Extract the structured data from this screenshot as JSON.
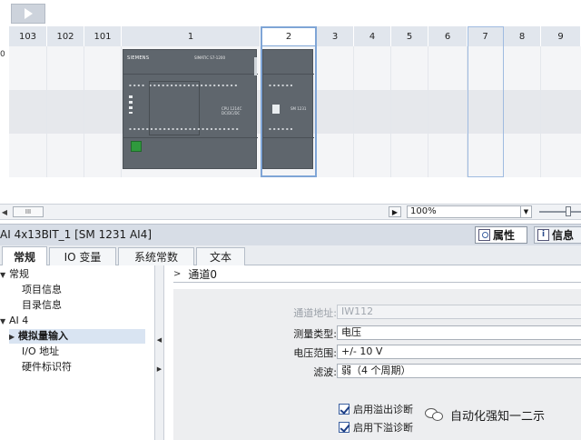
{
  "device_view": {
    "rail_label": "0",
    "slots": [
      "103",
      "102",
      "101",
      "1",
      "2",
      "3",
      "4",
      "5",
      "6",
      "7",
      "8",
      "9"
    ],
    "selected_slot": "2",
    "highlighted_slot": "7",
    "cpu_brand": "SIEMENS",
    "cpu_model": "SIMATIC S7-1200",
    "cpu_card_text": "CPU 1214C DC/DC/DC",
    "sm_card_text": "SM 1231"
  },
  "toolbar": {
    "scroll_thumb_glyph": "III",
    "zoom_value": "100%"
  },
  "inspector": {
    "title": "AI 4x13BIT_1 [SM 1231 AI4]",
    "properties_label": "属性",
    "info_label": "信息",
    "tabs": [
      "常规",
      "IO 变量",
      "系统常数",
      "文本"
    ],
    "active_tab": "常规"
  },
  "nav": {
    "items": [
      {
        "label": "常规",
        "level": 0,
        "expanded": true
      },
      {
        "label": "项目信息",
        "level": 1
      },
      {
        "label": "目录信息",
        "level": 1
      },
      {
        "label": "AI 4",
        "level": 0,
        "expanded": true
      },
      {
        "label": "模拟量输入",
        "level": 1,
        "selected": true
      },
      {
        "label": "I/O 地址",
        "level": 1
      },
      {
        "label": "硬件标识符",
        "level": 1
      }
    ]
  },
  "content": {
    "section_title": "通道0",
    "fields": [
      {
        "label": "通道地址:",
        "value": "IW112",
        "disabled": true
      },
      {
        "label": "测量类型:",
        "value": "电压"
      },
      {
        "label": "电压范围:",
        "value": "+/- 10 V"
      },
      {
        "label": "滤波:",
        "value": "弱（4 个周期）"
      }
    ],
    "checkboxes": [
      {
        "label": "启用溢出诊断",
        "checked": true
      },
      {
        "label": "启用下溢诊断",
        "checked": true
      }
    ]
  },
  "watermark": {
    "text": "自动化强知一二示"
  },
  "colors": {
    "slot_header_bg": "#e1e6ed",
    "selection_frame": "#7fa5d6",
    "module_body": "#5f666d",
    "inspector_title_bg": "#d7dde6",
    "panel_bg": "#edeef0"
  }
}
